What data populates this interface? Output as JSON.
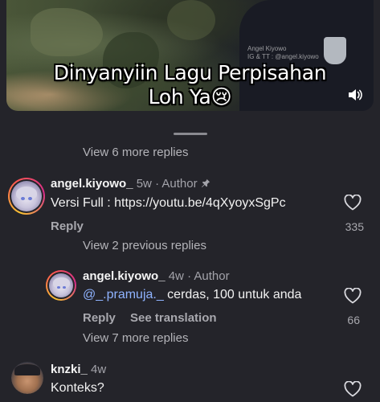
{
  "video": {
    "caption_line1": "Dinyanyiin Lagu Perpisahan",
    "caption_line2": "Loh Ya😢",
    "watermark_line1": "Angel Kiyowo",
    "watermark_line2": "IG & TT : @angel.kiyowo",
    "speaker_icon": "speaker-icon"
  },
  "thread": {
    "view_more_top": "View 6 more replies",
    "comments": [
      {
        "username": "angel.kiyowo_",
        "time": "5w",
        "badge": "· Author",
        "text": "Versi Full : https://youtu.be/4qXyoyxSgPc",
        "reply_label": "Reply",
        "likes": "335"
      }
    ],
    "view_previous": "View 2 previous replies",
    "reply": {
      "username": "angel.kiyowo_",
      "time": "4w",
      "badge": "· Author",
      "mention": "@_.pramuja._",
      "text": " cerdas, 100 untuk anda",
      "reply_label": "Reply",
      "translate_label": "See translation",
      "likes": "66"
    },
    "view_more_bottom": "View 7 more replies",
    "last_comment": {
      "username": "knzki_",
      "time": "4w",
      "text": "Konteks?"
    }
  }
}
